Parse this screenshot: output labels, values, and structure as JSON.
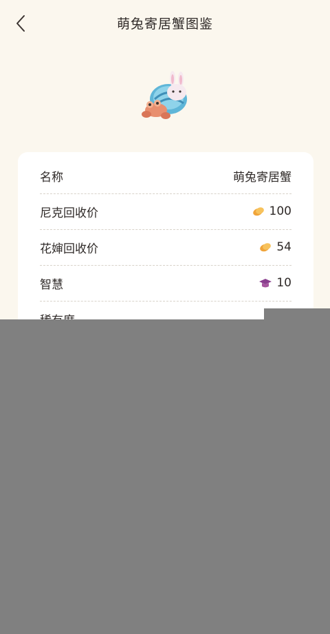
{
  "header": {
    "title": "萌兔寄居蟹图鉴"
  },
  "details": {
    "rows": [
      {
        "label": "名称",
        "value": "萌兔寄居蟹",
        "icon": ""
      },
      {
        "label": "尼克回收价",
        "value": "100",
        "icon": "coin-icon"
      },
      {
        "label": "花婶回收价",
        "value": "54",
        "icon": "coin-icon"
      },
      {
        "label": "智慧",
        "value": "10",
        "icon": "graduation-cap-icon"
      },
      {
        "label": "稀有度",
        "value": "",
        "icon": "star-icon"
      }
    ]
  },
  "colors": {
    "background": "#fbf7ee",
    "card": "#ffffff",
    "overlay": "#808080"
  }
}
